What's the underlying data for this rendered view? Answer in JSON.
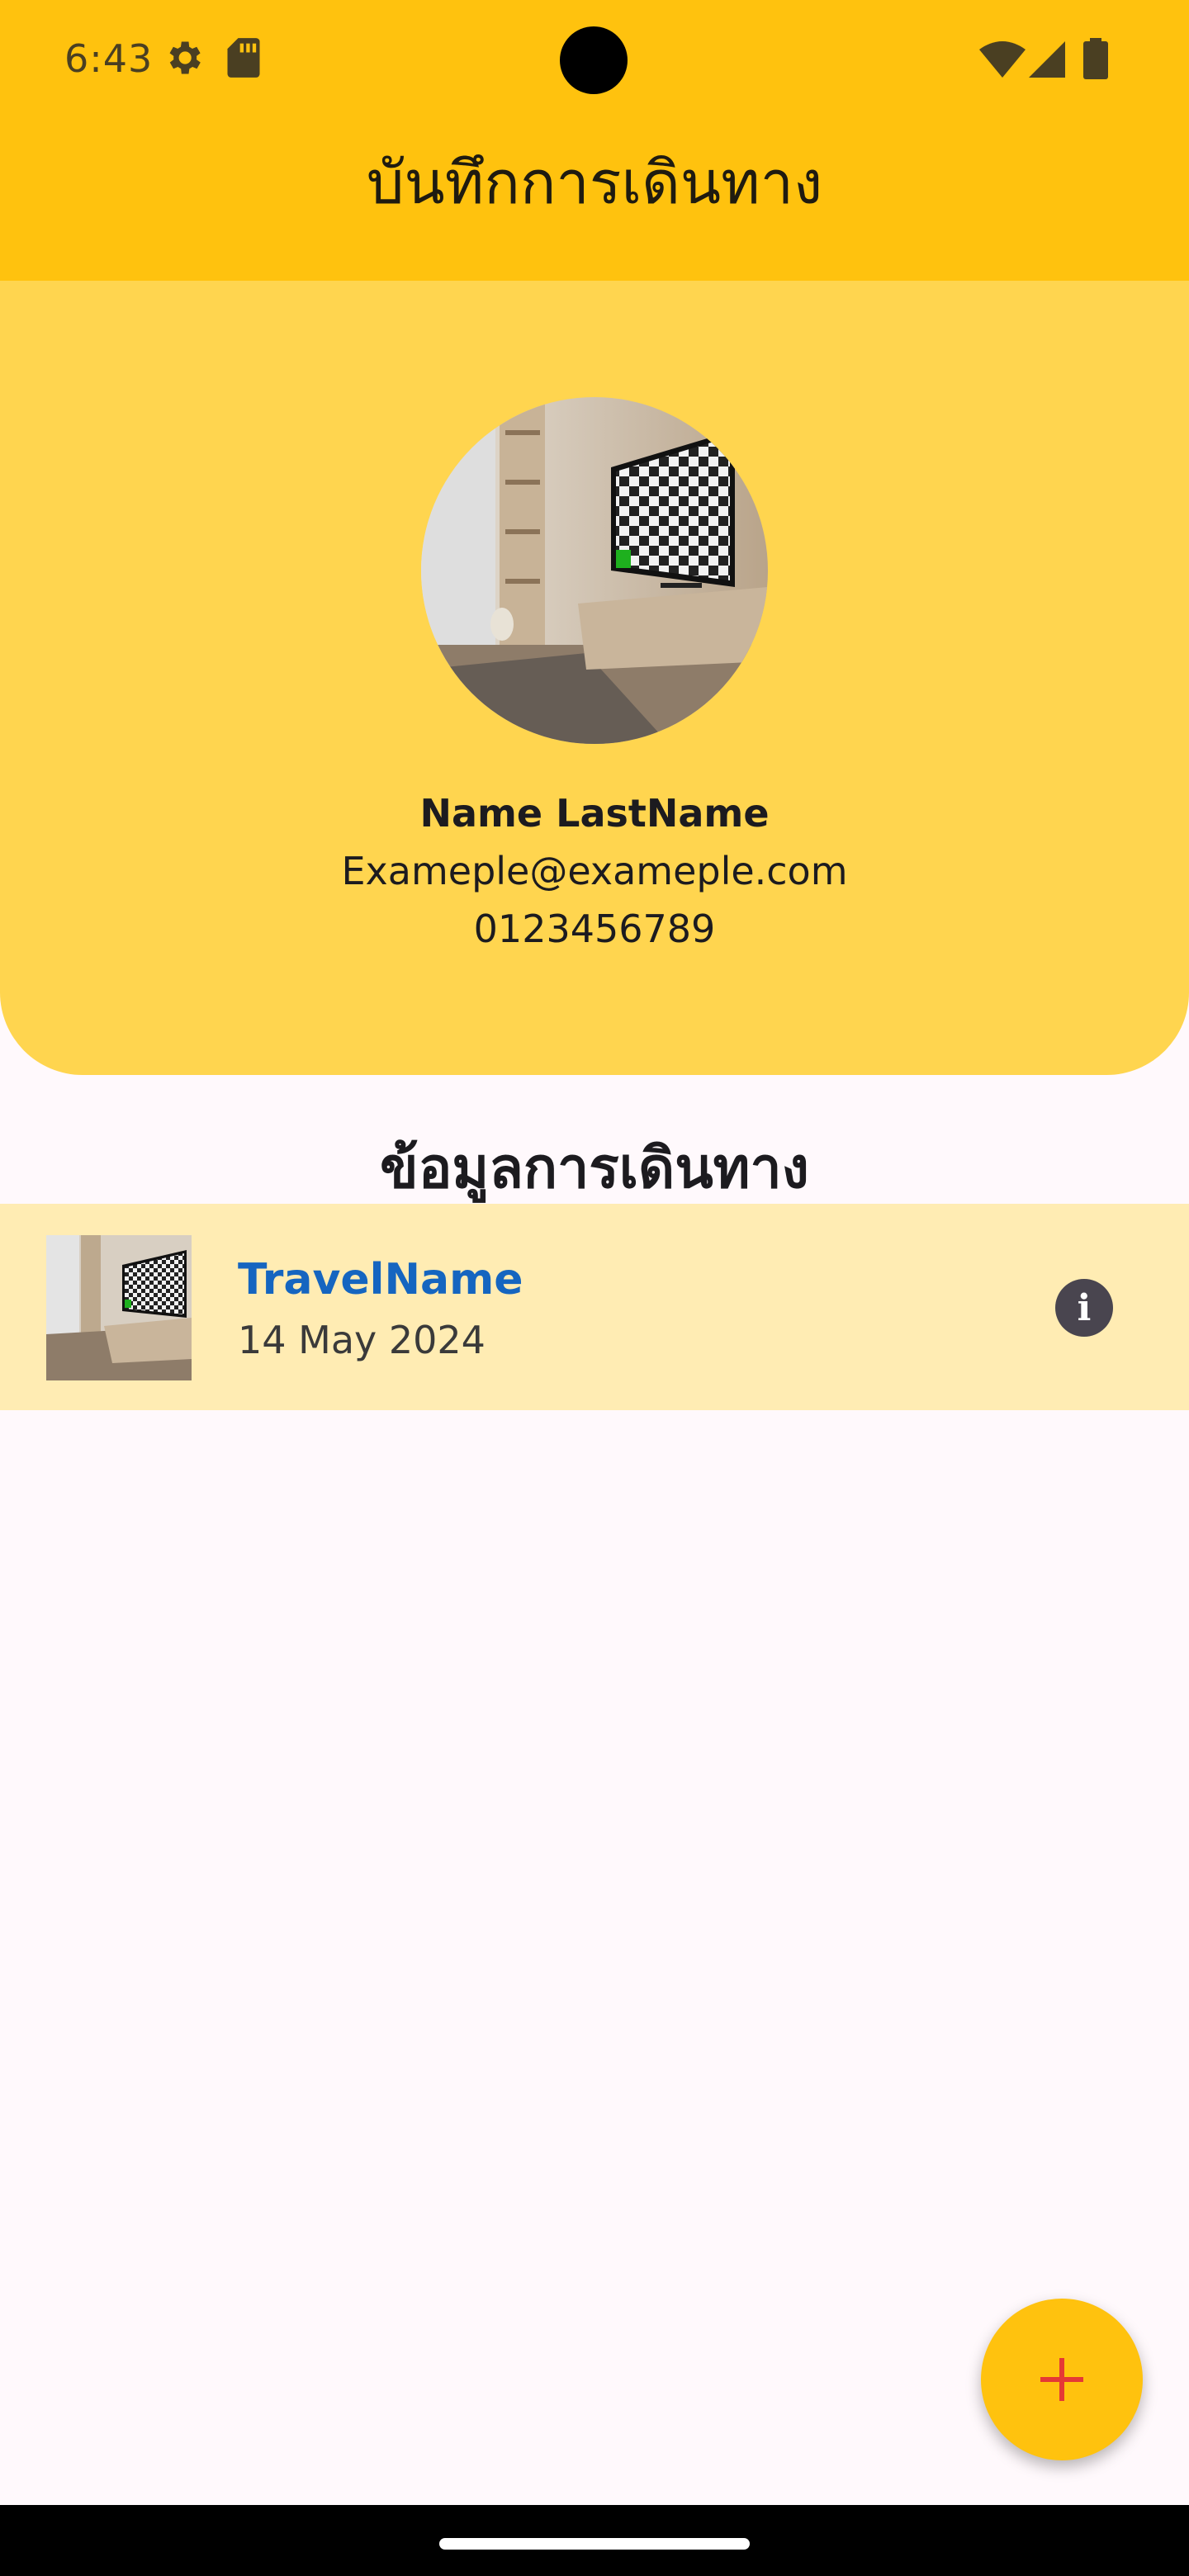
{
  "status_bar": {
    "time": "6:43",
    "icons_left": [
      "settings-icon",
      "sd-card-icon"
    ],
    "icons_right": [
      "wifi-icon",
      "cellular-signal-icon",
      "battery-icon"
    ]
  },
  "app_bar": {
    "title": "บันทึกการเดินทาง"
  },
  "profile": {
    "name": "Name LastName",
    "email": "Exameple@exameple.com",
    "phone": "0123456789",
    "avatar_icon": "profile-photo"
  },
  "section": {
    "title": "ข้อมูลการเดินทาง"
  },
  "travels": [
    {
      "name": "TravelName",
      "date": "14 May 2024",
      "action_icon": "info-icon"
    }
  ],
  "fab": {
    "icon": "plus-icon"
  },
  "colors": {
    "primary": "#FFC20E",
    "profile_bg": "#FFD54F",
    "list_item_bg": "#FFECB3",
    "travel_name": "#1565C0",
    "fab_plus": "#E53935",
    "background": "#FFF9FC"
  }
}
